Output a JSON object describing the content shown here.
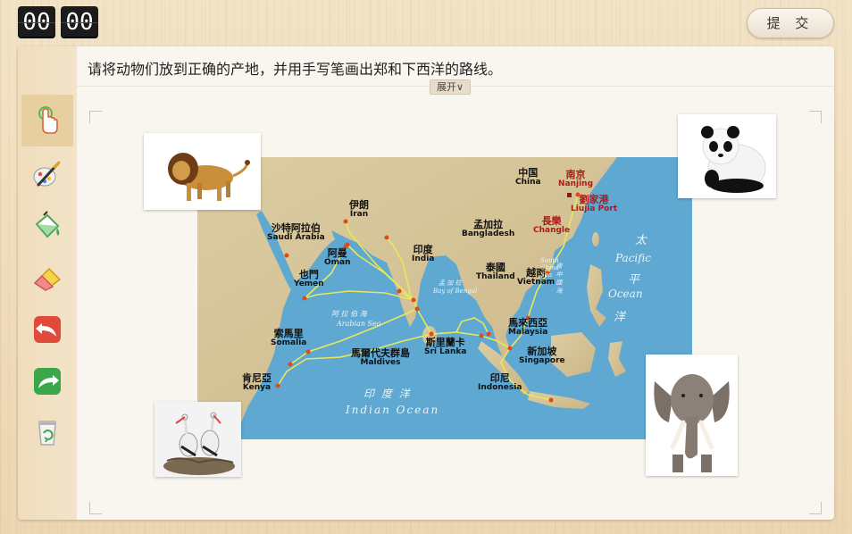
{
  "timer": {
    "minutes": "00",
    "seconds": "00"
  },
  "toolbar": {
    "submit_label": "提 交"
  },
  "question": {
    "text": "请将动物们放到正确的产地，并用手写笔画出郑和下西洋的路线。",
    "expand_label": "展开∨"
  },
  "tools": [
    {
      "name": "pointer-tool",
      "icon": "hand-pointer-icon"
    },
    {
      "name": "pen-tool",
      "icon": "brush-palette-icon"
    },
    {
      "name": "fill-tool",
      "icon": "paint-bucket-icon"
    },
    {
      "name": "eraser-tool",
      "icon": "eraser-icon"
    },
    {
      "name": "undo-tool",
      "icon": "undo-arrow-icon"
    },
    {
      "name": "redo-tool",
      "icon": "redo-arrow-icon"
    },
    {
      "name": "clear-tool",
      "icon": "recycle-bin-icon"
    }
  ],
  "map": {
    "labels": {
      "china": {
        "cn": "中国",
        "en": "China"
      },
      "nanjing": {
        "cn": "南京",
        "en": "Nanjing"
      },
      "liujia": {
        "cn": "劉家港",
        "en": "Liujia Port"
      },
      "changle": {
        "cn": "長樂",
        "en": "Changle"
      },
      "iran": {
        "cn": "伊朗",
        "en": "Iran"
      },
      "saudi": {
        "cn": "沙特阿拉伯",
        "en": "Saudi Arabia"
      },
      "oman": {
        "cn": "阿曼",
        "en": "Oman"
      },
      "yemen": {
        "cn": "也門",
        "en": "Yemen"
      },
      "india": {
        "cn": "印度",
        "en": "India"
      },
      "bangladesh": {
        "cn": "孟加拉",
        "en": "Bangladesh"
      },
      "thailand": {
        "cn": "泰國",
        "en": "Thailand"
      },
      "vietnam": {
        "cn": "越南",
        "en": "Vietnam"
      },
      "somalia": {
        "cn": "索馬里",
        "en": "Somalia"
      },
      "maldives": {
        "cn": "馬爾代夫群島",
        "en": "Maldives"
      },
      "srilanka": {
        "cn": "斯里蘭卡",
        "en": "Sri Lanka"
      },
      "malaysia": {
        "cn": "馬來西亞",
        "en": "Malaysia"
      },
      "singapore": {
        "cn": "新加坡",
        "en": "Singapore"
      },
      "indonesia": {
        "cn": "印尼",
        "en": "Indonesia"
      },
      "kenya": {
        "cn": "肯尼亞",
        "en": "Kenya"
      }
    },
    "oceans": {
      "indian_cn": "印 度 洋",
      "indian_en": "Indian Ocean",
      "pacific_cn1": "太",
      "pacific_cn2": "平",
      "pacific_cn3": "洋",
      "pacific_en1": "Pacific",
      "pacific_en2": "Ocean",
      "arabian_cn": "阿 拉 伯 海",
      "arabian_en": "Arabian Sea",
      "bengal_cn": "孟 加 拉",
      "bengal_en": "Bay of Bengal",
      "south_china_cn": "南 中 國 海",
      "south_china_en": "South China Sea"
    }
  },
  "animals": [
    "lion",
    "panda",
    "crane",
    "elephant"
  ],
  "colors": {
    "route": "#e8e85a",
    "port": "#e04a1a",
    "ocean": "#5ea8d1",
    "land": "#d6c49a"
  }
}
